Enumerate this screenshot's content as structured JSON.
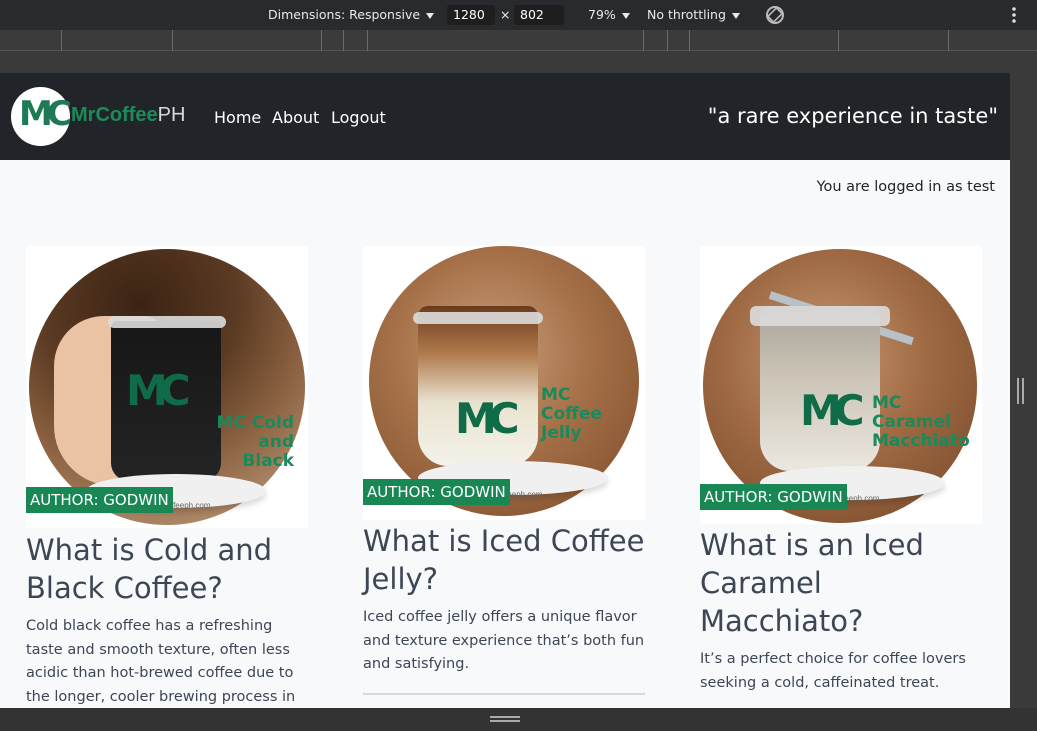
{
  "devtools": {
    "dimensions_label": "Dimensions: Responsive",
    "width": "1280",
    "times": "×",
    "height": "802",
    "zoom": "79%",
    "throttling": "No throttling",
    "rotate_icon": "rotate-icon",
    "more_icon": "more-vertical-icon"
  },
  "navbar": {
    "logo_text": "MC",
    "brand_main": "MrCoffee",
    "brand_suffix": "PH",
    "links": [
      "Home",
      "About",
      "Logout"
    ],
    "tagline": "\"a rare experience in taste\""
  },
  "status": {
    "logged_in": "You are logged in as test"
  },
  "cards": [
    {
      "author": "AUTHOR: GODWIN",
      "title": "What is Cold and Black Coffee?",
      "text": "Cold black coffee has a refreshing taste and smooth texture, often less acidic than hot-brewed coffee due to the longer, cooler brewing process in cold",
      "image_label": "MC Cold and Black",
      "image_logo": "MC",
      "image_site": "ffeeph.com"
    },
    {
      "author": "AUTHOR: GODWIN",
      "title": "What is Iced Coffee Jelly?",
      "text": "Iced coffee jelly offers a unique flavor and texture experience that’s both fun and satisfying.",
      "image_label": "MC Coffee Jelly",
      "image_logo": "MC",
      "image_site": "ffeeph.com"
    },
    {
      "author": "AUTHOR: GODWIN",
      "title": "What is an Iced Caramel Macchiato?",
      "text": "It’s a perfect choice for coffee lovers seeking a cold, caffeinated treat.",
      "image_label": "MC Caramel Macchiato",
      "image_logo": "MC",
      "image_site": "ffeeph.com"
    }
  ],
  "colors": {
    "navbar_bg": "#212529",
    "brand_green": "#198754",
    "page_bg": "#f8f9fa",
    "text": "#3c4654"
  }
}
